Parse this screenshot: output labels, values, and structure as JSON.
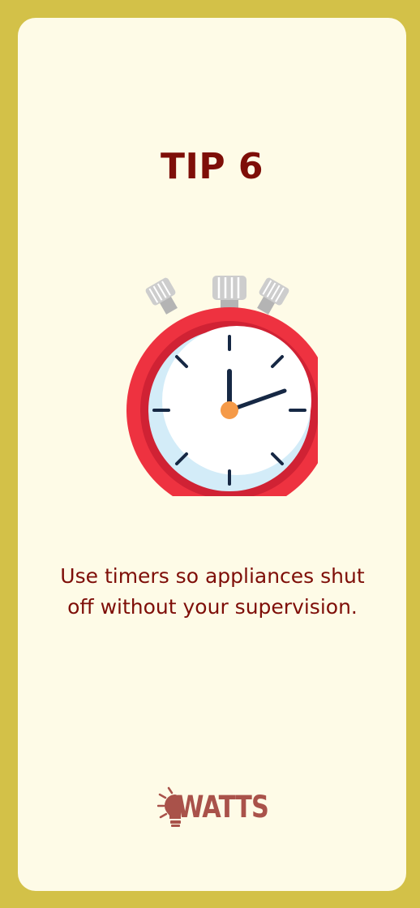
{
  "card": {
    "title": "TIP 6",
    "description": "Use timers so appliances shut off without your supervision."
  },
  "brand": {
    "name": "WATTS"
  },
  "colors": {
    "frame": "#d3c148",
    "card_background": "#fefbe7",
    "title_text": "#7e0e08",
    "logo": "#a9524a",
    "stopwatch_red": "#ee3240",
    "stopwatch_dark_red": "#d02234",
    "dial_face": "#ffffff",
    "dial_shadow": "#d3ecf8",
    "hands": "#162844",
    "center_pin": "#f59a48",
    "buttons": "#cdcdcd"
  },
  "icons": {
    "illustration": "stopwatch-icon",
    "logo_mark": "lightbulb-icon"
  }
}
